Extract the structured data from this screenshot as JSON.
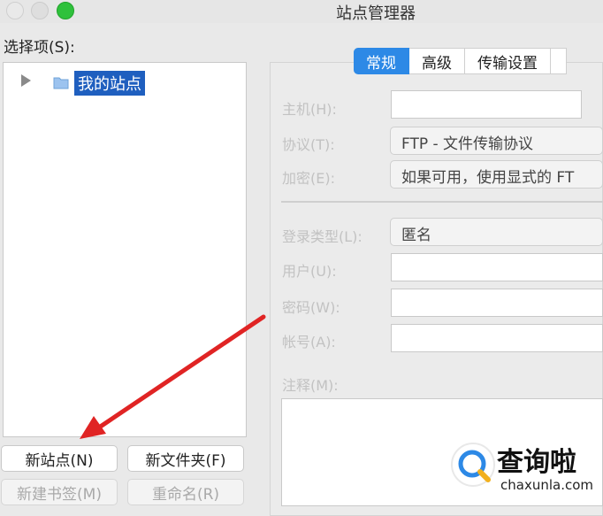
{
  "window": {
    "title": "站点管理器"
  },
  "sidebar": {
    "label": "选择项(S):",
    "tree": [
      {
        "label": "我的站点",
        "selected": true
      }
    ]
  },
  "buttons": {
    "new_site": "新站点(N)",
    "new_folder": "新文件夹(F)",
    "new_bookmark": "新建书签(M)",
    "rename": "重命名(R)"
  },
  "tabs": [
    {
      "label": "常规",
      "active": true
    },
    {
      "label": "高级",
      "active": false
    },
    {
      "label": "传输设置",
      "active": false
    }
  ],
  "form": {
    "host_label": "主机(H):",
    "host_value": "",
    "protocol_label": "协议(T):",
    "protocol_value": "FTP - 文件传输协议",
    "encryption_label": "加密(E):",
    "encryption_value": "如果可用，使用显式的 FT",
    "logon_label": "登录类型(L):",
    "logon_value": "匿名",
    "user_label": "用户(U):",
    "user_value": "",
    "password_label": "密码(W):",
    "password_value": "",
    "account_label": "帐号(A):",
    "account_value": "",
    "notes_label": "注释(M):",
    "notes_value": ""
  },
  "watermark": {
    "name": "查询啦",
    "url": "chaxunla.com"
  },
  "colors": {
    "accent": "#2d89e6",
    "selection": "#1f5fbf",
    "annotation_arrow": "#e02424"
  }
}
